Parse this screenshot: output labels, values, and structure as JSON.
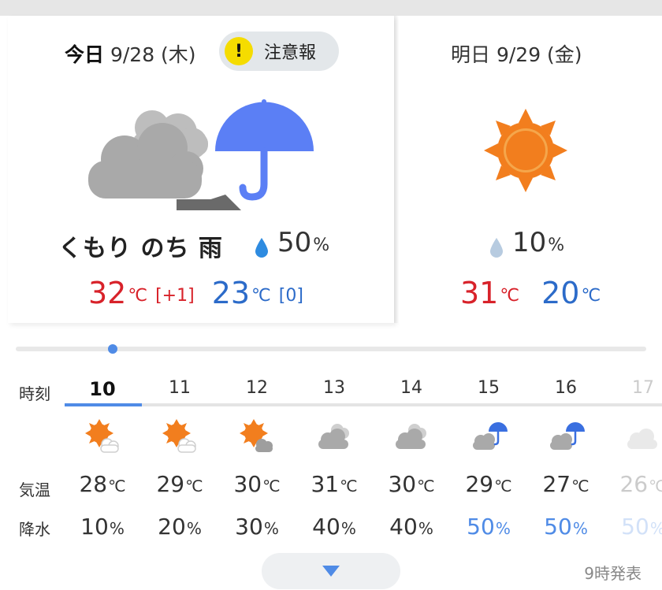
{
  "today": {
    "label": "今日",
    "date": "9/28 (木)",
    "alert": {
      "icon": "exclamation-icon",
      "text": "注意報"
    },
    "icon": "cloudy-then-rain-icon",
    "condition": "くもり のち 雨",
    "precip": {
      "value": "50",
      "unit": "%"
    },
    "high": {
      "value": "32",
      "unit": "℃",
      "diff": "[+1]"
    },
    "low": {
      "value": "23",
      "unit": "℃",
      "diff": "[0]"
    }
  },
  "tomorrow": {
    "label": "明日",
    "date": "9/29 (金)",
    "icon": "sunny-icon",
    "precip": {
      "value": "10",
      "unit": "%"
    },
    "high": {
      "value": "31",
      "unit": "℃"
    },
    "low": {
      "value": "20",
      "unit": "℃"
    }
  },
  "hourly": {
    "row_labels": {
      "time": "時刻",
      "temp": "気温",
      "precip": "降水"
    },
    "hours": [
      {
        "hour": "10",
        "icon": "sun-cloud-icon",
        "temp": "28",
        "precip": "10"
      },
      {
        "hour": "11",
        "icon": "sun-cloud-icon",
        "temp": "29",
        "precip": "20"
      },
      {
        "hour": "12",
        "icon": "sun-cloud-icon",
        "temp": "30",
        "precip": "30"
      },
      {
        "hour": "13",
        "icon": "cloud-icon",
        "temp": "31",
        "precip": "40"
      },
      {
        "hour": "14",
        "icon": "cloud-icon",
        "temp": "30",
        "precip": "40"
      },
      {
        "hour": "15",
        "icon": "cloud-umbrella-icon",
        "temp": "29",
        "precip": "50"
      },
      {
        "hour": "16",
        "icon": "cloud-umbrella-icon",
        "temp": "27",
        "precip": "50"
      },
      {
        "hour": "17",
        "icon": "cloud-icon",
        "temp": "26",
        "precip": "50"
      }
    ],
    "temp_unit": "℃",
    "precip_unit": "%"
  },
  "issued": "9時発表",
  "colors": {
    "high": "#d8222a",
    "low": "#2c6bc9",
    "accent": "#4f8be6",
    "alert": "#f5dc00"
  }
}
